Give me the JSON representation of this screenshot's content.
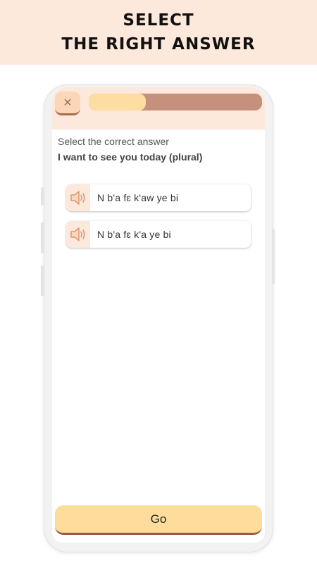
{
  "banner": {
    "line1": "SELECT",
    "line2": "THE RIGHT ANSWER"
  },
  "app": {
    "close_icon": "×",
    "progress_fraction": 0.33,
    "colors": {
      "header_bg": "#fde8dc",
      "progress_fill": "#fedda3",
      "progress_track": "#c5917c",
      "button_bg": "#fedd9c",
      "button_border": "#9c5a3c"
    }
  },
  "exercise": {
    "instruction": "Select the correct answer",
    "prompt": "I want to see you today (plural)",
    "options": [
      {
        "icon": "speaker-icon",
        "text": "N b'a fɛ k'aw ye bi"
      },
      {
        "icon": "speaker-icon",
        "text": "N b'a fɛ k'a ye bi"
      }
    ]
  },
  "footer": {
    "go_label": "Go"
  }
}
